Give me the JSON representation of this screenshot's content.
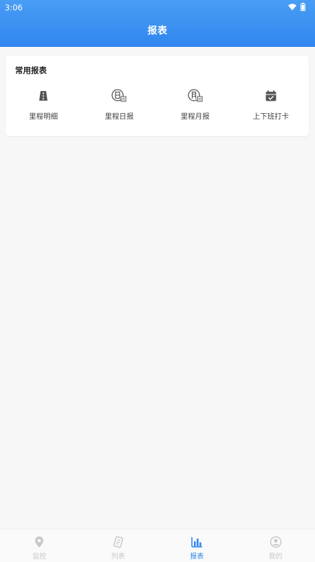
{
  "status_bar": {
    "time": "3:06"
  },
  "header": {
    "title": "报表"
  },
  "card": {
    "title": "常用报表",
    "items": [
      {
        "label": "里程明细",
        "icon": "road-icon"
      },
      {
        "label": "里程日报",
        "icon": "daily-report-icon"
      },
      {
        "label": "里程月报",
        "icon": "monthly-report-icon"
      },
      {
        "label": "上下班打卡",
        "icon": "calendar-check-icon"
      }
    ]
  },
  "tabbar": {
    "active_color": "#2f86ee",
    "items": [
      {
        "label": "监控",
        "icon": "location-pin-icon",
        "active": false
      },
      {
        "label": "列表",
        "icon": "list-icon",
        "active": false
      },
      {
        "label": "报表",
        "icon": "bar-chart-icon",
        "active": true
      },
      {
        "label": "我的",
        "icon": "user-icon",
        "active": false
      }
    ]
  }
}
